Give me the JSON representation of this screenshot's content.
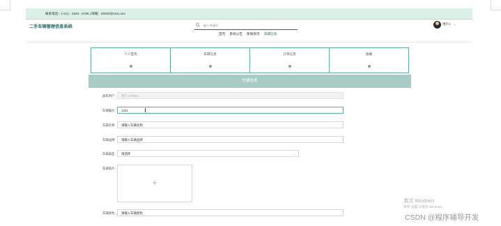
{
  "topbar": {
    "contact": "联系电话：(+61) - 2845 - 6789 | 邮箱：00000@163.com"
  },
  "header": {
    "site_title": "二手车辆管理信息系统",
    "search_placeholder": "输入关键词",
    "nav": [
      "首页",
      "系统公告",
      "新闻资讯",
      "车辆信息"
    ],
    "username": "用户1"
  },
  "cards": [
    "个人首页",
    "车辆信息",
    "订单信息",
    "收藏"
  ],
  "banner": "车辆信息",
  "form": {
    "account_label": "发布用户",
    "account_value": "用户1-00001",
    "number_label": "车辆编号",
    "number_value": "1201",
    "name_label": "车辆名称",
    "name_placeholder": "请输入车辆名称",
    "brand_label": "车辆品牌",
    "brand_placeholder": "请输入车辆品牌",
    "type_label": "车辆类型",
    "type_value": "请选择",
    "image_label": "车辆照片",
    "upload_symbol": "+",
    "color_label": "车辆颜色",
    "color_placeholder": "请输入车辆颜色"
  },
  "watermark": {
    "line1": "激活 Windows",
    "line2": "转到\"设置\"以激活 Windows。",
    "csdn": "CSDN @程序辅导开发"
  }
}
